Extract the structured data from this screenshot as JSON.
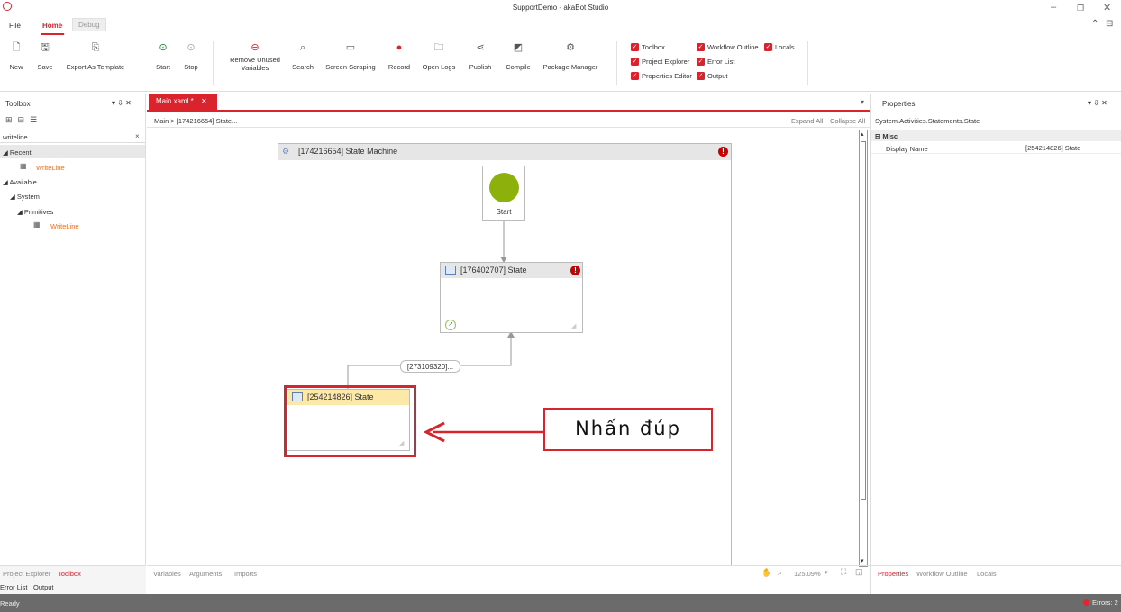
{
  "app": {
    "title": "SupportDemo - akaBot Studio"
  },
  "menu": {
    "file": "File",
    "home": "Home",
    "debug": "Debug"
  },
  "ribbon": {
    "new": "New",
    "save": "Save",
    "export": "Export As Template",
    "start": "Start",
    "stop": "Stop",
    "remove_unused_1": "Remove Unused",
    "remove_unused_2": "Variables",
    "search": "Search",
    "screen_scraping": "Screen Scraping",
    "record": "Record",
    "open_logs": "Open Logs",
    "publish": "Publish",
    "compile": "Compile",
    "package_manager": "Package Manager"
  },
  "toggles": {
    "toolbox": "Toolbox",
    "workflow_outline": "Workflow Outline",
    "locals": "Locals",
    "project_explorer": "Project Explorer",
    "error_list": "Error List",
    "properties_editor": "Properties Editor",
    "output": "Output"
  },
  "toolbox": {
    "title": "Toolbox",
    "pin": "▾ ⇩ ✕",
    "search_value": "writeline",
    "search_clear": "×",
    "recent": "◢ Recent",
    "recent_item": "WriteLine",
    "available": "◢ Available",
    "system": "◢ System",
    "primitives": "◢ Primitives",
    "prim_item": "WriteLine"
  },
  "left_bottom": {
    "project_explorer": "Project Explorer",
    "toolbox": "Toolbox",
    "error_list": "Error List",
    "output": "Output"
  },
  "editor": {
    "tab": "Main.xaml *",
    "tab_close": "✕",
    "breadcrumb": "Main  >  [174216654] State...",
    "expand_all": "Expand All",
    "collapse_all": "Collapse All",
    "state_machine": "[174216654] State Machine",
    "start_label": "Start",
    "state1": "[176402707] State",
    "transition": "[273109320]...",
    "state2": "[254214826] State",
    "callout": "Nhấn đúp"
  },
  "editor_bottom": {
    "variables": "Variables",
    "arguments": "Arguments",
    "imports": "Imports",
    "zoom": "125.09%"
  },
  "properties": {
    "title": "Properties",
    "pin": "▾ ⇩ ✕",
    "type": "System.Activities.Statements.State",
    "category": "⊟ Misc",
    "display_name_label": "Display Name",
    "display_name_value": "[254214826] State"
  },
  "right_bottom": {
    "properties": "Properties",
    "workflow_outline": "Workflow Outline",
    "locals": "Locals"
  },
  "status": {
    "ready": "Ready",
    "errors": "Errors: 2"
  },
  "colors": {
    "accent": "#d9232d",
    "start_circle": "#8db10b",
    "selected_header": "#fce9a8",
    "orange_link": "#e8702a"
  }
}
